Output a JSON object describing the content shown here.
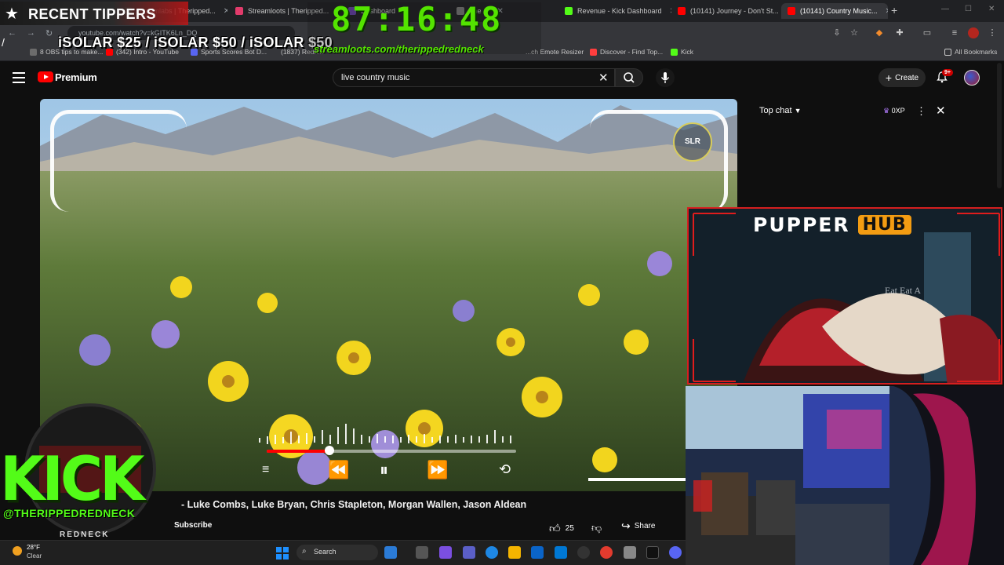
{
  "browser": {
    "tabs": [
      {
        "label": "Streamlabs | Theripped...",
        "active": false
      },
      {
        "label": "Streamloots | Theripped...",
        "active": false
      },
      {
        "label": "Dashboard",
        "active": false
      },
      {
        "label": "The ...",
        "active": false
      },
      {
        "label": "Revenue - Kick Dashboard",
        "active": false
      },
      {
        "label": "(10141) Journey - Don't St...",
        "active": false
      },
      {
        "label": "(10141) Country Music...",
        "active": true
      }
    ],
    "url": "youtube.com/watch?v=kGITK6Ln_DQ",
    "bookmarks": [
      "8 OBS tips to make...",
      "(342) Intro - YouTube",
      "Sports Scores Bot D...",
      "(1837) Redn...",
      "...ch Emote Resizer",
      "Discover - Find Top...",
      "Kick",
      "All Bookmarks"
    ]
  },
  "overlay": {
    "recent_tippers_title": "RECENT TIPPERS",
    "recent_tippers_list": "iSOLAR $25 / iSOLAR $50 / iSOLAR $50",
    "timer": "87:16:48",
    "streamloots_url": "streamloots.com/therippedredneck",
    "kick_logo": "KICK",
    "kick_handle": "@THERIPPEDREDNECK",
    "kick_sub": "REDNECK",
    "pupper_word": "PUPPER",
    "hub_word": "HUB"
  },
  "youtube": {
    "brand": "Premium",
    "search_query": "live country music",
    "create_label": "Create",
    "notif_badge": "9+",
    "video_title": "- Luke Combs, Luke Bryan, Chris Stapleton, Morgan Wallen, Jason Aldean",
    "subscribe_label": "Subscribe",
    "likes": "25",
    "share_label": "Share",
    "chat_title": "Top chat",
    "xp_badge": "0XP",
    "progress": 0.25
  },
  "taskbar": {
    "temperature": "28°F",
    "condition": "Clear",
    "search_label": "Search"
  },
  "colors": {
    "kick_green": "#53fc18",
    "timer_green": "#54e400",
    "yt_red": "#ff0000",
    "hub_orange": "#f39c12",
    "hub_border": "#d61f1f"
  }
}
